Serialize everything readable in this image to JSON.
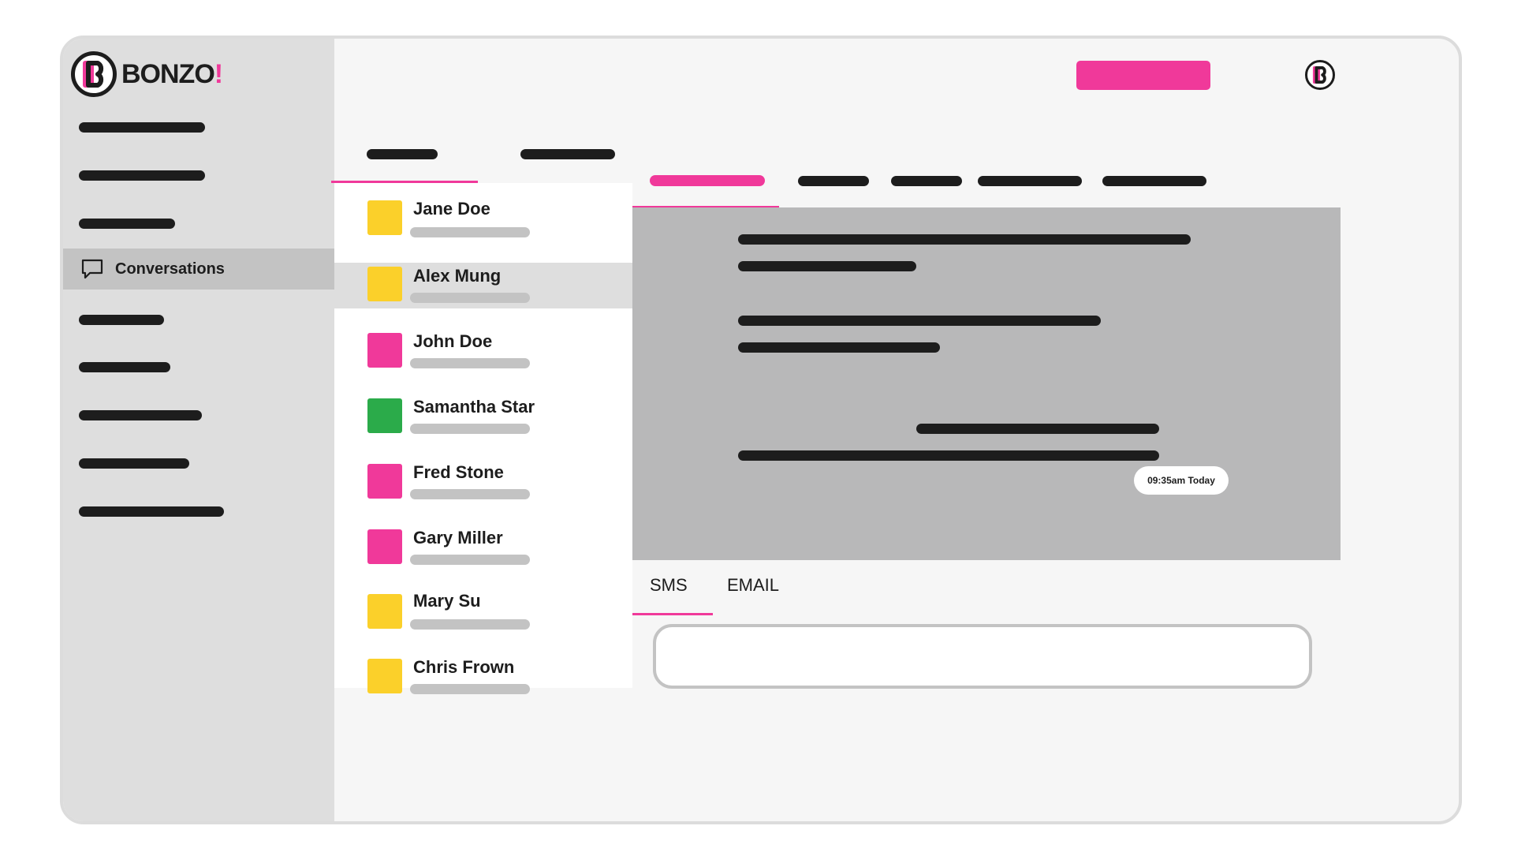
{
  "app": {
    "logo_text": "BONZO",
    "logo_bang": "!",
    "brand_color": "#f0399a"
  },
  "sidebar": {
    "active_item": {
      "label": "Conversations",
      "icon": "chat-bubble-icon"
    }
  },
  "contacts": [
    {
      "name": "Jane Doe",
      "color": "#fbd02a",
      "selected": false
    },
    {
      "name": "Alex Mung",
      "color": "#fbd02a",
      "selected": true
    },
    {
      "name": "John Doe",
      "color": "#f0399a",
      "selected": false
    },
    {
      "name": "Samantha Star",
      "color": "#2bab4a",
      "selected": false
    },
    {
      "name": "Fred Stone",
      "color": "#f0399a",
      "selected": false
    },
    {
      "name": "Gary Miller",
      "color": "#f0399a",
      "selected": false
    },
    {
      "name": "Mary Su",
      "color": "#fbd02a",
      "selected": false
    },
    {
      "name": "Chris Frown",
      "color": "#fbd02a",
      "selected": false
    }
  ],
  "conversation": {
    "timestamp": "09:35am Today"
  },
  "composer": {
    "tabs": [
      "SMS",
      "EMAIL"
    ],
    "active_tab": "SMS",
    "placeholder": ""
  }
}
